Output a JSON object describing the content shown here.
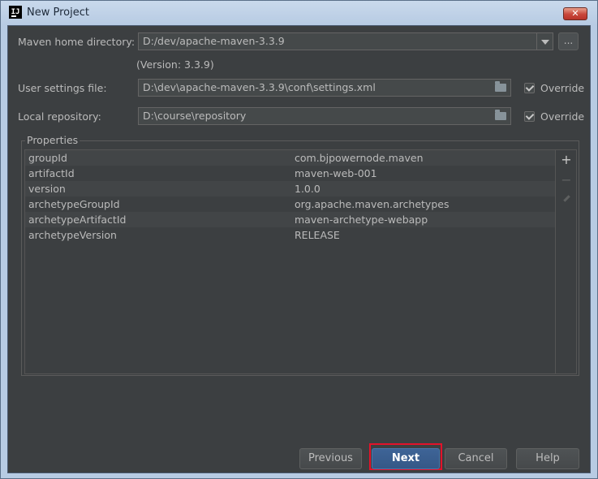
{
  "window": {
    "title": "New Project",
    "close_glyph": "✕"
  },
  "maven_home": {
    "label": "Maven home directory:",
    "value": "D:/dev/apache-maven-3.3.9",
    "version": "(Version: 3.3.9)",
    "browse_label": "..."
  },
  "user_settings": {
    "label": "User settings file:",
    "value": "D:\\dev\\apache-maven-3.3.9\\conf\\settings.xml",
    "override_label": "Override",
    "override_checked": true
  },
  "local_repo": {
    "label": "Local repository:",
    "value": "D:\\course\\repository",
    "override_label": "Override",
    "override_checked": true
  },
  "properties": {
    "title": "Properties",
    "rows": [
      {
        "key": "groupId",
        "value": "com.bjpowernode.maven"
      },
      {
        "key": "artifactId",
        "value": "maven-web-001"
      },
      {
        "key": "version",
        "value": "1.0.0"
      },
      {
        "key": "archetypeGroupId",
        "value": "org.apache.maven.archetypes"
      },
      {
        "key": "archetypeArtifactId",
        "value": "maven-archetype-webapp"
      },
      {
        "key": "archetypeVersion",
        "value": "RELEASE"
      }
    ],
    "add_glyph": "+",
    "remove_glyph": "−"
  },
  "buttons": {
    "previous": "Previous",
    "next": "Next",
    "cancel": "Cancel",
    "help": "Help"
  },
  "colors": {
    "panel_bg": "#3c3f41",
    "primary_button": "#365880",
    "highlight_border": "#e3122a"
  }
}
